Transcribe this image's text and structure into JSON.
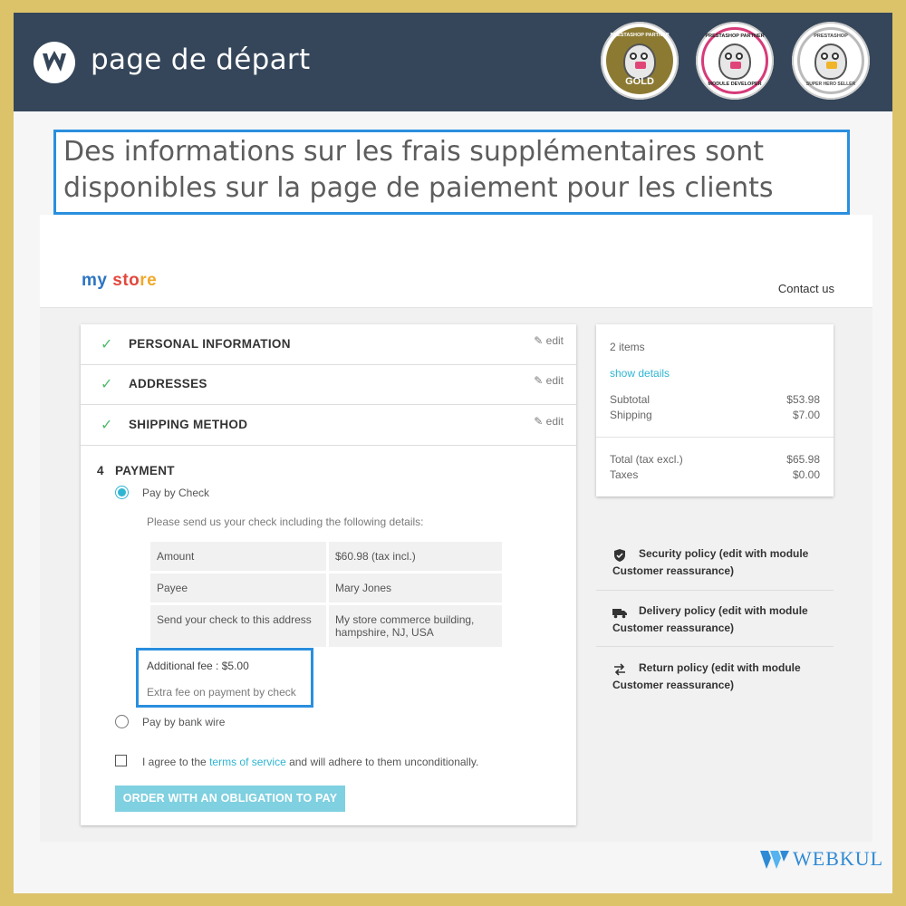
{
  "header": {
    "title": "page de départ",
    "badges": [
      {
        "ring_text": "PRESTASHOP PARTNER",
        "label": "GOLD",
        "color": "#8c7a32"
      },
      {
        "ring_text": "PRESTASHOP PARTNER",
        "label": "MODULE DEVELOPER",
        "color": "#d63b7a"
      },
      {
        "ring_text": "PRESTASHOP",
        "label": "SUPER HERO SELLER",
        "color": "#2f66b0"
      }
    ]
  },
  "caption": {
    "text": "Des informations sur les frais supplémentaires sont disponibles sur la page de paiement pour les clients"
  },
  "store": {
    "logo": {
      "part1": "my ",
      "part2": "sto",
      "part3": "re"
    },
    "contact": "Contact us"
  },
  "checkout": {
    "steps": [
      {
        "title": "PERSONAL INFORMATION",
        "edit": "edit"
      },
      {
        "title": "ADDRESSES",
        "edit": "edit"
      },
      {
        "title": "SHIPPING METHOD",
        "edit": "edit"
      }
    ],
    "payment_title": "4   PAYMENT",
    "option_check": "Pay by Check",
    "check_intro": "Please send us your check including the following details:",
    "details": [
      {
        "label": "Amount",
        "value": "$60.98 (tax incl.)"
      },
      {
        "label": "Payee",
        "value": "Mary Jones"
      },
      {
        "label": "Send your check to this address",
        "value": "My store commerce building, hampshire, NJ, USA"
      }
    ],
    "additional_fee": "Additional fee : $5.00",
    "fee_note": "Extra fee on payment by check",
    "option_wire": "Pay by bank wire",
    "agree_prefix": "I agree to the ",
    "agree_link": "terms of service",
    "agree_suffix": " and will adhere to them unconditionally.",
    "order_button": "ORDER WITH AN OBLIGATION TO PAY"
  },
  "summary": {
    "items": "2 items",
    "show_details": "show details",
    "subtotal_label": "Subtotal",
    "subtotal_value": "$53.98",
    "shipping_label": "Shipping",
    "shipping_value": "$7.00",
    "total_label": "Total (tax excl.)",
    "total_value": "$65.98",
    "taxes_label": "Taxes",
    "taxes_value": "$0.00"
  },
  "reassurance": [
    {
      "icon": "shield-icon",
      "text": "Security policy (edit with module Customer reassurance)"
    },
    {
      "icon": "truck-icon",
      "text": "Delivery policy (edit with module Customer reassurance)"
    },
    {
      "icon": "return-arrows-icon",
      "text": "Return policy (edit with module Customer reassurance)"
    }
  ],
  "footer": {
    "brand": "WEBKUL"
  },
  "colors": {
    "accent": "#2fb5d2",
    "highlight": "#2a8fde",
    "header_bg": "#35465a",
    "border_gold": "#dcc36a",
    "check_green": "#4cbb6c"
  }
}
